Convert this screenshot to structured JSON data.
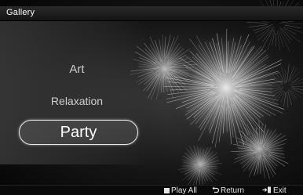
{
  "title": "Gallery",
  "menu": {
    "items": [
      {
        "label": "Art"
      },
      {
        "label": "Relaxation"
      },
      {
        "label": "Party",
        "selected": true
      }
    ]
  },
  "help_bar": {
    "play_all": "Play All",
    "return": "Return",
    "exit": "Exit"
  },
  "icons": {
    "play_all": "stop-square-icon",
    "return": "return-arrow-icon",
    "exit": "exit-icon"
  },
  "colors": {
    "background": "#000000",
    "text": "#ffffff",
    "menu_text": "#cfcfcf"
  }
}
